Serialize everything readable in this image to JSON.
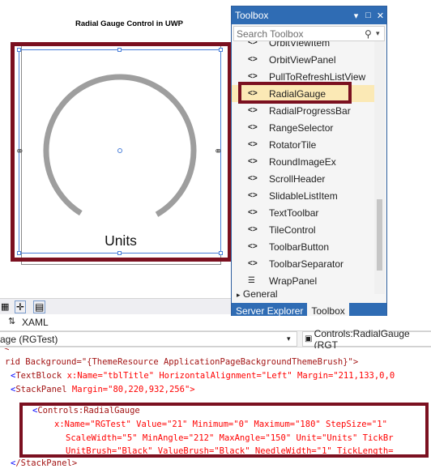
{
  "designer": {
    "title": "Radial Gauge Control in UWP",
    "units_label": "Units",
    "gauge": {
      "minimum": 0,
      "maximum": 180,
      "value": 21,
      "min_angle": 212,
      "max_angle": 150
    }
  },
  "toolbox": {
    "title": "Toolbox",
    "search_placeholder": "Search Toolbox",
    "items": [
      "OrbitViewItem",
      "OrbitViewPanel",
      "PullToRefreshListView",
      "RadialGauge",
      "RadialProgressBar",
      "RangeSelector",
      "RotatorTile",
      "RoundImageEx",
      "ScrollHeader",
      "SlidableListItem",
      "TextToolbar",
      "TileControl",
      "ToolbarButton",
      "ToolbarSeparator",
      "WrapPanel"
    ],
    "selected_item": "RadialGauge",
    "group": "General",
    "tabs": [
      "Server Explorer",
      "Toolbox"
    ]
  },
  "xaml_tab": "XAML",
  "scope": {
    "left": "age (RGTest)",
    "right": "Controls:RadialGauge (RGT"
  },
  "code": {
    "line0": "rid Background=\"{ThemeResource ApplicationPageBackgroundThemeBrush}\">",
    "line1_tag": "TextBlock",
    "line1_attrs": "x:Name=\"tblTitle\" HorizontalAlignment=\"Left\" Margin=\"211,133,0,0",
    "line2_tag": "StackPanel",
    "line2_attrs": "Margin=\"80,220,932,256\">",
    "line3": "Controls:RadialGauge",
    "line4": "x:Name=\"RGTest\" Value=\"21\" Minimum=\"0\" Maximum=\"180\" StepSize=\"1\"",
    "line5": "ScaleWidth=\"5\" MinAngle=\"212\" MaxAngle=\"150\" Unit=\"Units\" TickBr",
    "line6": "UnitBrush=\"Black\" ValueBrush=\"Black\" NeedleWidth=\"1\" TickLength=",
    "line7": "/StackPanel>"
  }
}
